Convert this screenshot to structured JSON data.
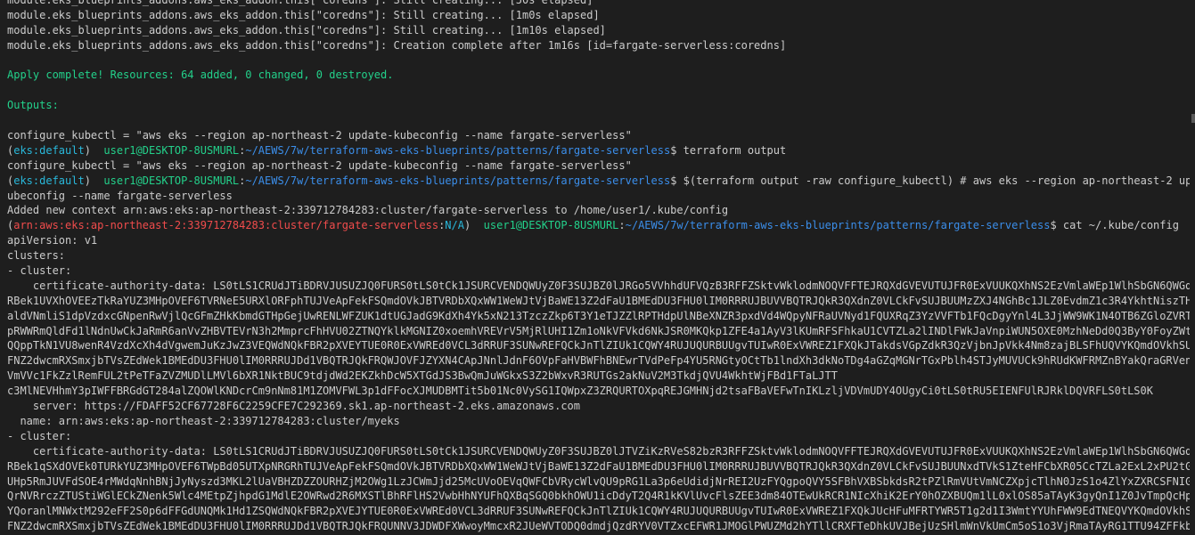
{
  "colors": {
    "background": "#1e1e1e",
    "text": "#cccccc",
    "green": "#23d18b",
    "cyan": "#29b8db",
    "yellow": "#e5e510",
    "blue": "#3b8eea",
    "magenta": "#d670d6",
    "red": "#f14c4c"
  },
  "terminal": {
    "lines": [
      [
        {
          "t": "module.eks_blueprints_addons.aws_eks_addon.this[\"coredns\"]: Still creating... [50s elapsed]",
          "c": "plain"
        }
      ],
      [
        {
          "t": "module.eks_blueprints_addons.aws_eks_addon.this[\"coredns\"]: Still creating... [1m0s elapsed]",
          "c": "plain"
        }
      ],
      [
        {
          "t": "module.eks_blueprints_addons.aws_eks_addon.this[\"coredns\"]: Still creating... [1m10s elapsed]",
          "c": "plain"
        }
      ],
      [
        {
          "t": "module.eks_blueprints_addons.aws_eks_addon.this[\"coredns\"]: Creation complete after 1m16s [id=fargate-serverless:coredns]",
          "c": "plain"
        }
      ],
      [
        {
          "t": "",
          "c": "plain"
        }
      ],
      [
        {
          "t": "Apply complete! Resources: 64 added, 0 changed, 0 destroyed.",
          "c": "green"
        }
      ],
      [
        {
          "t": "",
          "c": "plain"
        }
      ],
      [
        {
          "t": "Outputs:",
          "c": "green"
        }
      ],
      [
        {
          "t": "",
          "c": "plain"
        }
      ],
      [
        {
          "t": "configure_kubectl = \"aws eks --region ap-northeast-2 update-kubeconfig --name fargate-serverless\"",
          "c": "plain"
        }
      ],
      [
        {
          "t": "(",
          "c": "plain"
        },
        {
          "t": "eks:default",
          "c": "cyan"
        },
        {
          "t": ")  ",
          "c": "plain"
        },
        {
          "t": "user1@DESKTOP-8USMURL",
          "c": "green"
        },
        {
          "t": ":",
          "c": "plain"
        },
        {
          "t": "~/AEWS/7w/terraform-aws-eks-blueprints/patterns/fargate-serverless",
          "c": "blue"
        },
        {
          "t": "$ terraform output",
          "c": "plain"
        }
      ],
      [
        {
          "t": "configure_kubectl = \"aws eks --region ap-northeast-2 update-kubeconfig --name fargate-serverless\"",
          "c": "plain"
        }
      ],
      [
        {
          "t": "(",
          "c": "plain"
        },
        {
          "t": "eks:default",
          "c": "cyan"
        },
        {
          "t": ")  ",
          "c": "plain"
        },
        {
          "t": "user1@DESKTOP-8USMURL",
          "c": "green"
        },
        {
          "t": ":",
          "c": "plain"
        },
        {
          "t": "~/AEWS/7w/terraform-aws-eks-blueprints/patterns/fargate-serverless",
          "c": "blue"
        },
        {
          "t": "$ $(terraform output -raw configure_kubectl) # aws eks --region ap-northeast-2 update-k",
          "c": "plain"
        }
      ],
      [
        {
          "t": "ubeconfig --name fargate-serverless",
          "c": "plain"
        }
      ],
      [
        {
          "t": "Added new context arn:aws:eks:ap-northeast-2:339712784283:cluster/fargate-serverless to /home/user1/.kube/config",
          "c": "plain"
        }
      ],
      [
        {
          "t": "(",
          "c": "plain"
        },
        {
          "t": "arn:aws:eks:ap-northeast-2:339712784283:cluster/fargate-serverless",
          "c": "red"
        },
        {
          "t": ":",
          "c": "plain"
        },
        {
          "t": "N/A",
          "c": "cyan"
        },
        {
          "t": ")  ",
          "c": "plain"
        },
        {
          "t": "user1@DESKTOP-8USMURL",
          "c": "green"
        },
        {
          "t": ":",
          "c": "plain"
        },
        {
          "t": "~/AEWS/7w/terraform-aws-eks-blueprints/patterns/fargate-serverless",
          "c": "blue"
        },
        {
          "t": "$ cat ~/.kube/config",
          "c": "plain"
        }
      ],
      [
        {
          "t": "apiVersion: v1",
          "c": "plain"
        }
      ],
      [
        {
          "t": "clusters:",
          "c": "plain"
        }
      ],
      [
        {
          "t": "- cluster:",
          "c": "plain"
        }
      ],
      [
        {
          "t": "    certificate-authority-data: LS0tLS1CRUdJTiBDRVJUSUZJQ0FURS0tLS0tCk1JSURCVENDQWUyZ0F3SUJBZ0lJRGo5VVhhdUFVQzB3RFFZSktvWklodmNOQVFFTEJRQXdGVEVUTUJFR0ExVUUKQXhNS2EzVmlaWEp1WlhSbGN6QWGdzB5Tl",
          "c": "plain"
        }
      ],
      [
        {
          "t": "RBek1UVXhOVEEzTkRaYUZ3MHpOVEF6TVRNeE5URXlORFphTUJVeApFekFSQmdOVkJBTVRDbXQxWW1WeWJtVjBaWE13Z2dFaU1BMEdDU3FHU0lIM0RRRUJBUVVBQTRJQkR3QXdnZ0VLCkFvSUJBUUMzZXJ4NGhBc1JLZ0EvdmZ1c3R4YkhtNiszTHExZjhy",
          "c": "plain"
        }
      ],
      [
        {
          "t": "aldVNmliS1dpVzdxcGNpenRwVjlQcGFmZHkKbmdGTHpGejUwRENLWFZUK1dtUGJadG9KdXh4Yk5xN213TzczZkp6T3Y1eTJZZlRPTHdpUlNBeXNZR3pxdVd4WQpyNFRaUVNyd1FQUXRqZ3YzVVFTb1FQcDgyYnl4L3JjWW9WK1N4OTB6ZGloZVRTVXVDY2",
          "c": "plain"
        }
      ],
      [
        {
          "t": "pRWWRmQldFd1lNdnUwCkJaRmR6anVvZHBVTEVrN3h2MmprcFhHVU02ZTNQYklkMGNIZ0xoemhVREVrV5MjRlUHI1Zm1oNkVFVkd6NkJSR0MKQkp1ZFE4a1AyV3lKUmRFSFhkaU1CVTZLa2lINDlFWkJaVnpiWUN5OXE0MzhNeDd0Q3ByY0FoyZWtHWkdCV044",
          "c": "plain"
        }
      ],
      [
        {
          "t": "QQppTkN1VU8wenR4VzdXcXh4dVgwemJuKzJwZ3VEQWdNQkFBR2pXVEYTUE0R0ExVWREd0VCL3dRRUF3SUNwREFQCkJnTlZIUk1CQWY4RUJUQURBUUgvTUIwR0ExVWREZ1FXQkJTakdsVGpZdkR3QzVjbnJpVkk4Nm8zajBLSFhUQVYKQmdOVkhSUVEak",
          "c": "plain"
        }
      ],
      [
        {
          "t": "FNZ2dwcmRXSmxjbTVsZEdWek1BMEdDU3FHU0lIM0RRRUJDd1VBQTRJQkFRQWJOVFJZYXN4CApJNnlJdnF6OVpFaHVBWFhBNEwrTVdPeFp4YU5RNGtyOCtTb1lndXh3dkNoTDg4aGZqMGNrTGxPblh4STJyMUVUCk9hRUdKWFRMZnBYakQraGRVenZMRWJQ",
          "c": "plain"
        }
      ],
      [
        {
          "t": "VmVVc1FkZzlRemFUL2tPeTFaZVZMUDlLMVl6bXR1NktBUC9tdjdWd2EKZkhDcW5XTGdJS3BwQmJuWGkxS3Z2bWxvR3RUTGs2akNuV2M3TkdjQVU4WkhtWjFBd1FTaLJTT",
          "c": "plain"
        },
        {
          "t": "                                                                                  ",
          "c": "plain"
        },
        {
          "t": "OejFhK2",
          "c": "plain"
        }
      ],
      [
        {
          "t": "c3MlNEVHhmY3pIWFFBRGdGT284alZQOWlKNDcrCm9nNm81M1ZOMVFWL3p1dFFocXJMUDBMTit5b01Nc0VySG1IQWpxZ3ZRQURTOXpqREJGMHNjd2tsaFBaVEFwTnIKLzljVDVmUDY4OUgyCi0tLS0tRU5EIENFUlRJRklDQVRFLS0tLS0K",
          "c": "plain"
        }
      ],
      [
        {
          "t": "    server: https://FDAFF52CF67728F6C2259CFE7C292369.sk1.ap-northeast-2.eks.amazonaws.com",
          "c": "plain"
        }
      ],
      [
        {
          "t": "  name: arn:aws:eks:ap-northeast-2:339712784283:cluster/myeks",
          "c": "plain"
        }
      ],
      [
        {
          "t": "- cluster:",
          "c": "plain"
        }
      ],
      [
        {
          "t": "    certificate-authority-data: LS0tLS1CRUdJTiBDRVJUSUZJQ0FURS0tLS0tCk1JSURCVENDQWUyZ0F3SUJBZ0lJTVZiKzRVeS82bzR3RFFZSktvWklodmNOQVFFTEJRQXdGVEVUTUJFR0ExVUUKQXhNS2EzVmlaWEp1WlhSbGN6QWGdzB5Tl",
          "c": "plain"
        }
      ],
      [
        {
          "t": "RBek1qSXdOVEk0TURkYUZ3MHpOVEF6TWpBd05UTXpNRGRhTUJVeApFekFSQmdOVkJBTVRDbXQxWW1WeWJtVjBaWE13Z2dFaU1BMEdDU3FHU0lIM0RRRUJBUVVBQTRJQkR3QXdnZ0VLCkFvSUJBUUNxdTVkS1ZteHFCbXR05CcTZLa2ExL2xPU2tGZXV5",
          "c": "plain"
        }
      ],
      [
        {
          "t": "UHp5RmJUVFdSOE4rMWdqNnhBNjJyNyszd3MKL2lUaVBHZDZZOURHZjM2OWg1LzJCWmJjd25McUVoOEVqQWFCbVRycWlvQU9pRG1La3p6eUdidjNrREI2UzFYQgpoQVY5SFBhVXBSbkdsR2tPZlRmVUtVmNCZXpjcTlhN0JzS1o4ZlYxZXRCSFNIGlVYV",
          "c": "plain"
        }
      ],
      [
        {
          "t": "QrNVRrczZTUStiWGlECkZNenk5Wlc4MEtpZjhpdG1MdlE2OWRwd2R6MXSTlBhRFlHS2VwbHhNYUFhQXBqSGQ0bkhOWU1icDdyT2Q4R1kKVlUvcFlsZEE3dm84OTEwUkRCR1NIcXhiK2ErY0hOZXBUQm1lL0xlOS85aTAyK3gyQnI1Z0JvTmpQcHplWUpN",
          "c": "plain"
        }
      ],
      [
        {
          "t": "YQoranlMNWxtM292eFF2S0p6dFFGdUNQMk1Hd1ZSQWdNQkFBR2pXVEJYTUE0R0ExVWREd0VCL3dRRUF3SUNwREFQCkJnTlZIUk1CQWY4RUJUQURBUUgvTUIwR0ExVWREZ1FXQkJUcHFuMFRTYWR5T1g2d1I3WmtYYUhFWW9EdTNEQVYKQmdOVkhSUVEak",
          "c": "plain"
        }
      ],
      [
        {
          "t": "FNZ2dwcmRXSmxjbTVsZEdWek1BMEdDU3FHU0lIM0RRRUJDd1VBQTRJQkFRQUNNV3JDWDFXWwoyMmcxR2JUeWVTODQ0dmdjQzdRYV0VTZxcEFWR1JMOGlPWUZMd2hYTllCRXFTeDhkUVJBejUzSHlmWnVkUmCm5oS1o3VjRmaTAyRG1TTU94ZFFkbm0W",
          "c": "plain"
        }
      ]
    ]
  }
}
